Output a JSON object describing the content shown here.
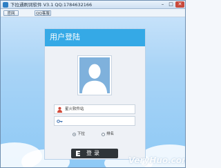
{
  "window": {
    "title": "下拉通刷词软件 V3.1   QQ:1784632166",
    "minimize_glyph": "–",
    "maximize_glyph": "□",
    "close_glyph": "✕"
  },
  "toolbar": {
    "home_label": "官网",
    "qq_label": "QQ客服"
  },
  "login_panel": {
    "title": "用户登陆",
    "username_value": "星火软件站",
    "password_value": "",
    "modes": [
      {
        "label": "下拉",
        "checked": true
      },
      {
        "label": "排名",
        "checked": false
      }
    ],
    "login_label": "登录"
  },
  "watermark": "VeryHuo.com",
  "colors": {
    "header_blue": "#35a9e6",
    "login_button": "#2f3438",
    "background_sky": "#8ec9f5"
  }
}
